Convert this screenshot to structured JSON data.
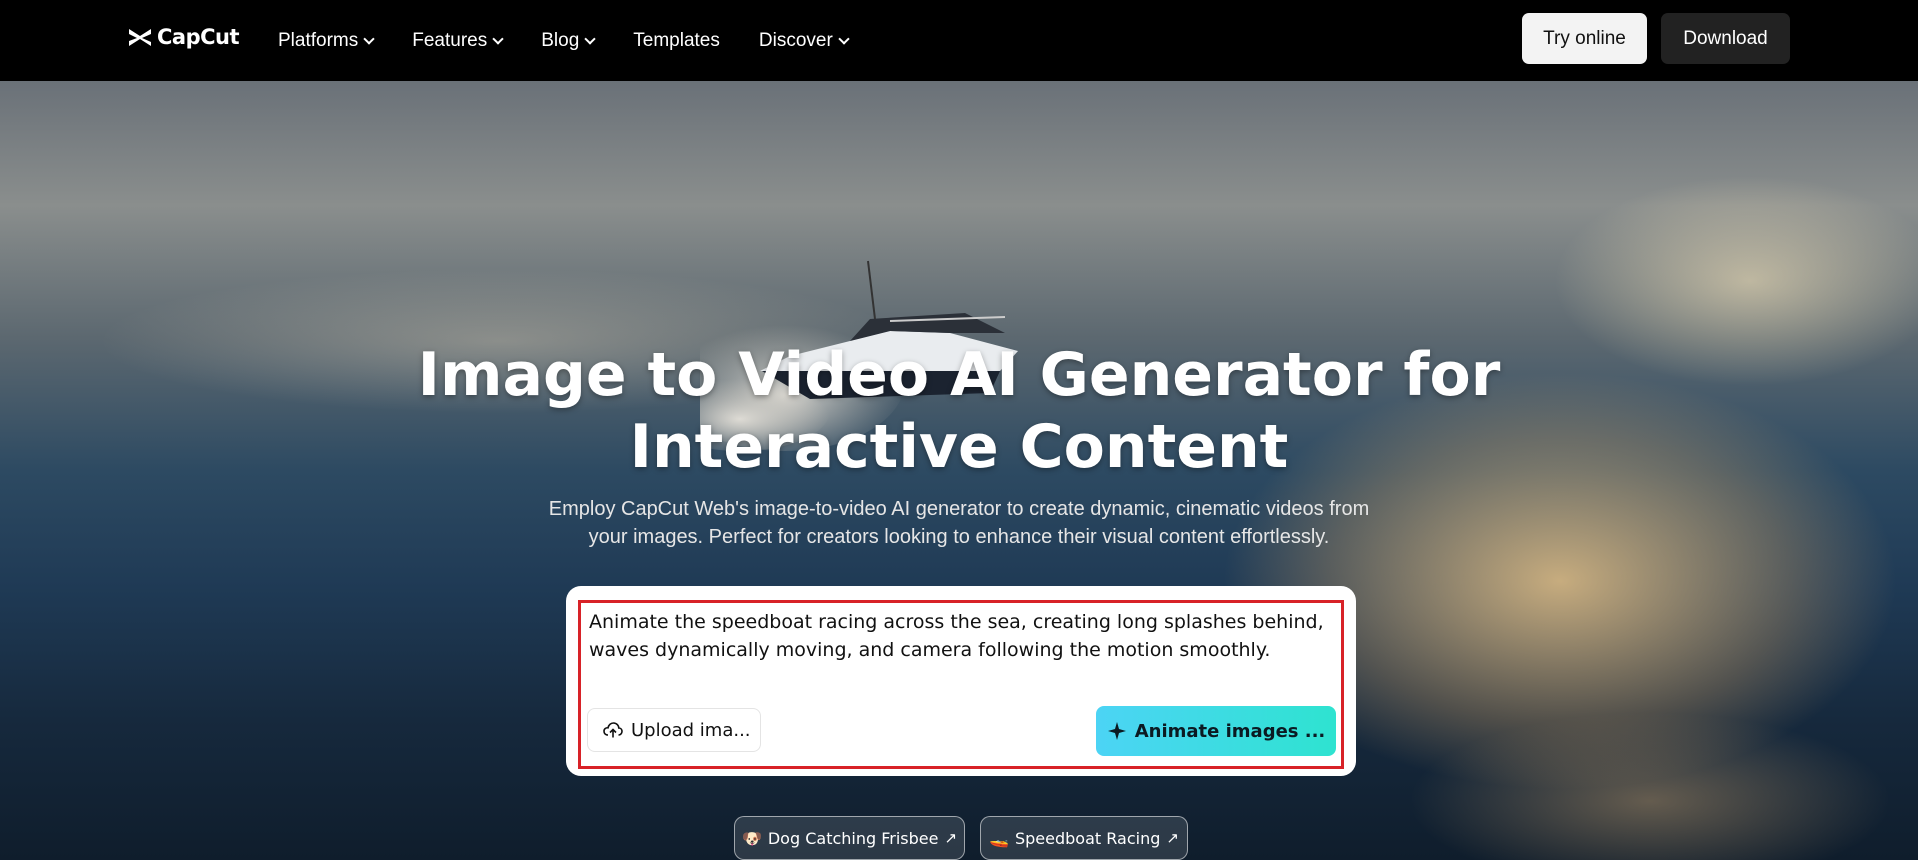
{
  "brand": {
    "name": "CapCut"
  },
  "nav": {
    "items": [
      {
        "label": "Platforms",
        "has_dropdown": true
      },
      {
        "label": "Features",
        "has_dropdown": true
      },
      {
        "label": "Blog",
        "has_dropdown": true
      },
      {
        "label": "Templates",
        "has_dropdown": false
      },
      {
        "label": "Discover",
        "has_dropdown": true
      }
    ],
    "try_online": "Try online",
    "download": "Download"
  },
  "hero": {
    "title_line1": "Image to Video AI Generator for",
    "title_line2": "Interactive Content",
    "subtitle_line1": "Employ CapCut Web's image-to-video AI generator to create dynamic, cinematic videos from",
    "subtitle_line2": "your images. Perfect for creators looking to enhance their visual content effortlessly."
  },
  "prompt": {
    "value": "Animate the speedboat racing across the sea, creating long splashes behind, waves dynamically moving, and camera following the motion smoothly.",
    "upload_label": "Upload ima...",
    "animate_label": "Animate images ...",
    "highlight_color": "#d82228",
    "accent_gradient": [
      "#4cd4f5",
      "#2ee3d0"
    ]
  },
  "examples": [
    {
      "emoji": "🐶",
      "label": "Dog Catching Frisbee"
    },
    {
      "emoji": "🚤",
      "label": "Speedboat Racing"
    }
  ]
}
